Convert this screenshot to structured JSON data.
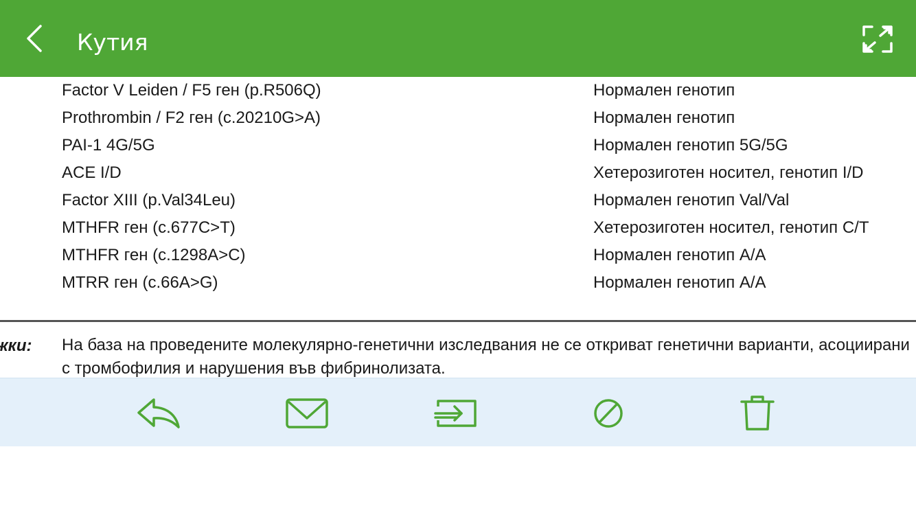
{
  "header": {
    "title": "Кутия"
  },
  "icons": {
    "back": "chevron-left-icon",
    "expand": "expand-icon",
    "reply": "reply-icon",
    "mail": "mail-icon",
    "move": "move-to-folder-icon",
    "block": "block-icon",
    "trash": "trash-icon"
  },
  "colors": {
    "header_bg": "#4fa736",
    "toolbar_bg": "#e4f0fa",
    "icon": "#4fa736"
  },
  "document": {
    "rows": [
      {
        "test": "Factor V Leiden / F5 ген (p.R506Q)",
        "result": "Нормален генотип"
      },
      {
        "test": "Prothrombin / F2 ген (c.20210G>A)",
        "result": "Нормален генотип"
      },
      {
        "test": "PAI-1 4G/5G",
        "result": "Нормален генотип 5G/5G"
      },
      {
        "test": "ACE I/D",
        "result": "Хетерозиготен носител, генотип I/D"
      },
      {
        "test": "Factor XIII (p.Val34Leu)",
        "result": "Нормален генотип Val/Val"
      },
      {
        "test": "MTHFR ген (c.677C>T)",
        "result": "Хетерозиготен носител, генотип C/T"
      },
      {
        "test": "MTHFR ген (c.1298A>C)",
        "result": "Нормален генотип A/A"
      },
      {
        "test": "MTRR ген (c.66A>G)",
        "result": "Нормален генотип A/A"
      }
    ],
    "notes_label": "жки:",
    "notes_text": "На база на проведените молекулярно-генетични изследвания не се откриват генетични варианти, асоциирани с тромбофилия и нарушения във фибринолизата."
  }
}
